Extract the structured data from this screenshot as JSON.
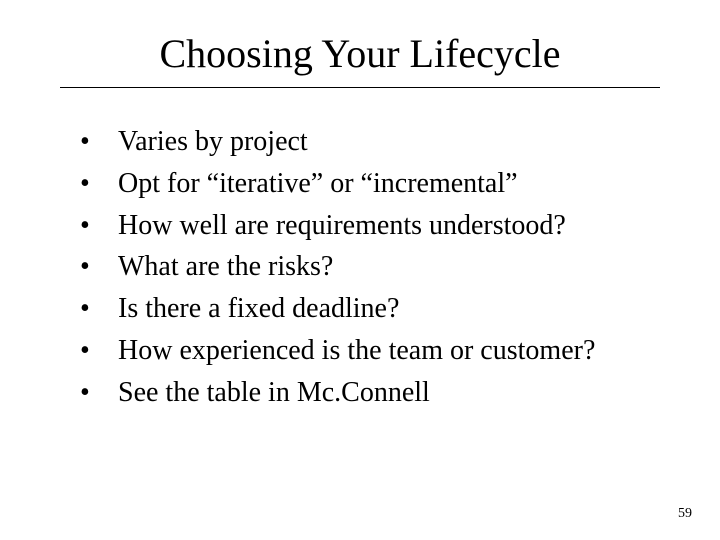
{
  "title": "Choosing Your Lifecycle",
  "bullets": [
    "Varies by project",
    "Opt for “iterative” or “incremental”",
    "How well are requirements understood?",
    "What are the risks?",
    "Is there a fixed deadline?",
    "How experienced is the team or customer?",
    "See the table in Mc.Connell"
  ],
  "page_number": "59"
}
